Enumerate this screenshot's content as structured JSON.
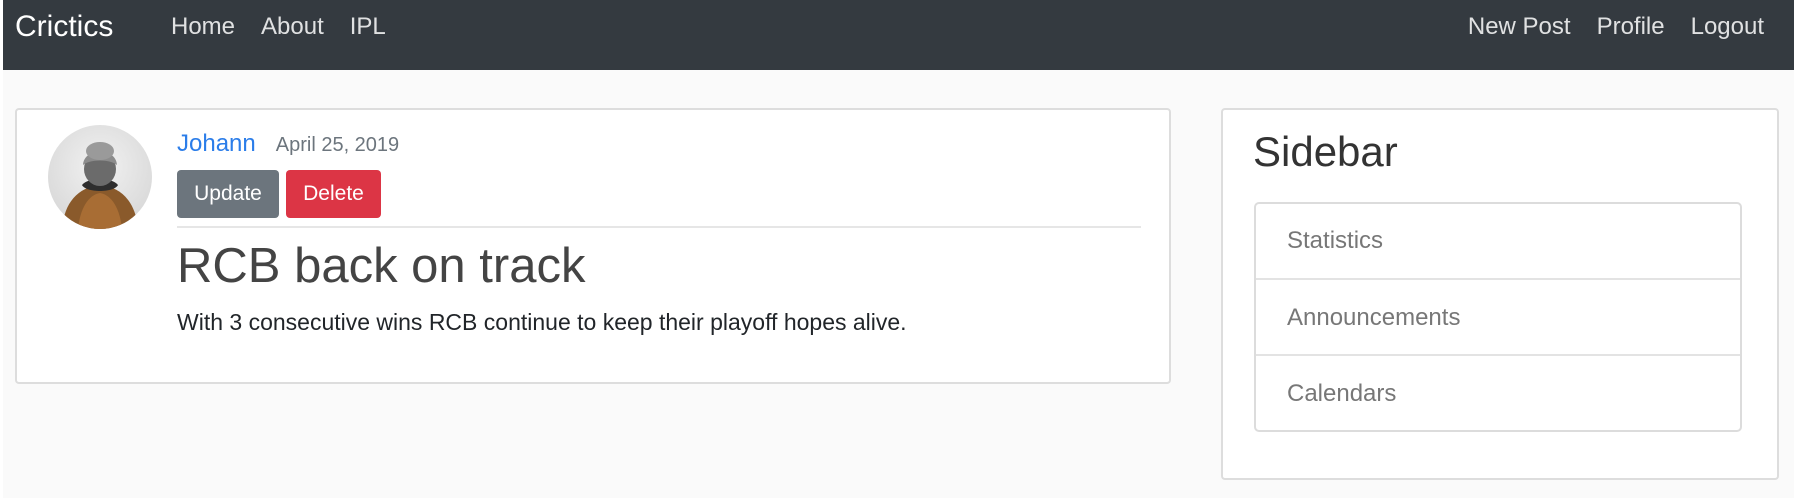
{
  "navbar": {
    "brand": "Crictics",
    "left_links": [
      {
        "label": "Home"
      },
      {
        "label": "About"
      },
      {
        "label": "IPL"
      }
    ],
    "right_links": [
      {
        "label": "New Post"
      },
      {
        "label": "Profile"
      },
      {
        "label": "Logout"
      }
    ],
    "colors": {
      "background": "#343a40"
    }
  },
  "post": {
    "author": "Johann",
    "date": "April 25, 2019",
    "update_label": "Update",
    "delete_label": "Delete",
    "title": "RCB back on track",
    "content": "With 3 consecutive wins RCB continue to keep their playoff hopes alive.",
    "colors": {
      "author_link": "#2b7de9",
      "update_button": "#6c757d",
      "delete_button": "#dc3545"
    }
  },
  "sidebar": {
    "title": "Sidebar",
    "items": [
      {
        "label": "Statistics"
      },
      {
        "label": "Announcements"
      },
      {
        "label": "Calendars"
      }
    ]
  }
}
